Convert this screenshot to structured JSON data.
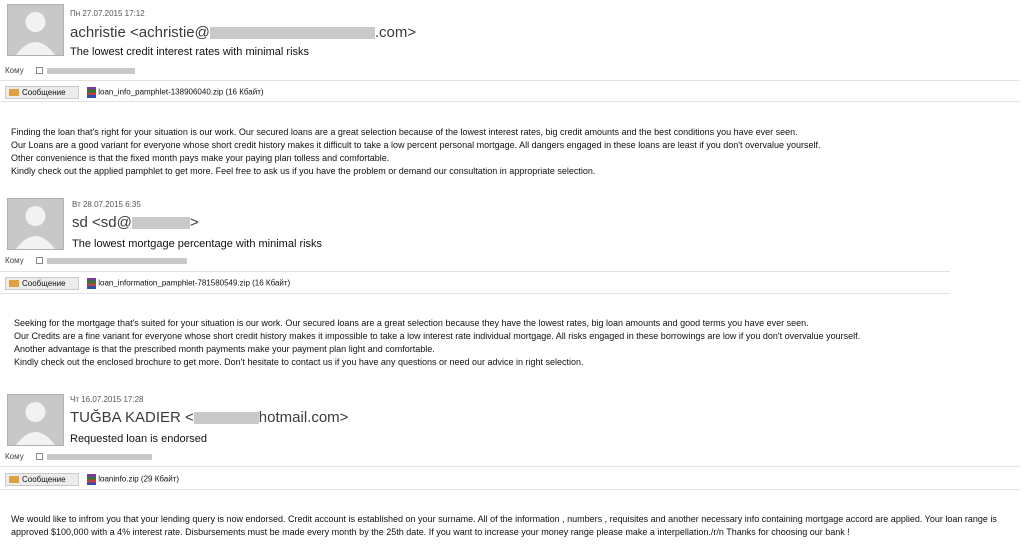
{
  "emails": [
    {
      "date": "Пн 27.07.2015 17:12",
      "sender": "achristie <achristie@",
      "sender_end": ".com>",
      "subject": "The lowest credit interest rates with minimal risks",
      "to_label": "Кому",
      "tab_label": "Сообщение",
      "attachment": "loan_info_pamphlet-138906040.zip (16 Кбайт)",
      "body": [
        "Finding the loan that's right for your situation is our work. Our secured loans are a great selection because of the lowest interest rates, big credit amounts and the best conditions you have ever seen.",
        "Our Loans are a good variant for everyone whose short credit history makes it difficult to take a low percent personal mortgage. All dangers engaged in these loans are least if you don't overvalue yourself.",
        "Other convenience is that the fixed month pays make your paying plan tolless and comfortable.",
        "Kindly check out the applied pamphlet to get more. Feel free to ask us if you have the problem or demand our consultation in appropriate selection."
      ]
    },
    {
      "date": "Вт 28.07.2015 6:35",
      "sender": "sd <sd@",
      "sender_end": ">",
      "subject": "The lowest mortgage percentage with minimal risks",
      "to_label": "Кому",
      "tab_label": "Сообщение",
      "attachment": "loan_information_pamphlet-781580549.zip (16 Кбайт)",
      "body": [
        "Seeking for the mortgage that's suited for your situation is our work. Our secured loans are a great selection because they have the lowest rates, big loan amounts and good terms you have ever seen.",
        "Our Credits are a fine variant for everyone whose short credit history makes it impossible to take a low interest rate individual mortgage. All risks engaged in these borrowings are low if you don't overvalue yourself.",
        "Another advantage is that the prescribed month payments make your payment plan light and comfortable.",
        "Kindly check out the enclosed brochure to get more. Don't hesitate to contact us if you have any questions or need our advice in right selection."
      ]
    },
    {
      "date": "Чт 16.07.2015 17:28",
      "sender": "TUĞBA KADIER <",
      "sender_end": "hotmail.com>",
      "subject": "Requested loan is endorsed",
      "to_label": "Кому",
      "tab_label": "Сообщение",
      "attachment": "loaninfo.zip (29 Кбайт)",
      "body": [
        "We would like to infrom you that your lending query is now endorsed. Credit account is established on your surname. All of the information , numbers , requisites and another necessary info containing mortgage accord are applied. Your loan range is approved $100,000 with a 4% interest rate. Disbursements must be made every month by the 25th date. If you want to increase your money range please make a interpellation./r/n Thanks for choosing our bank !"
      ]
    }
  ]
}
